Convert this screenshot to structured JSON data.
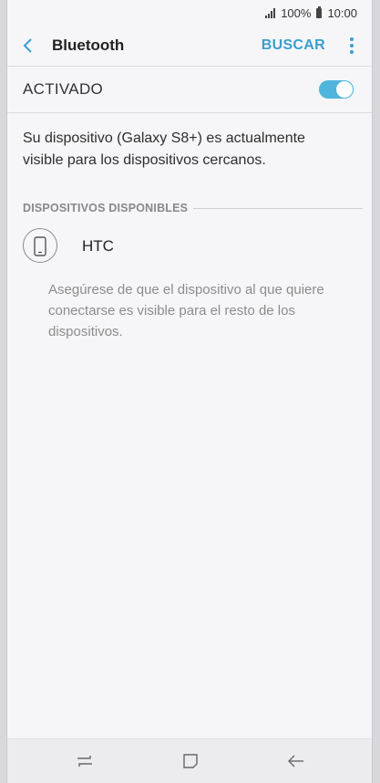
{
  "status_bar": {
    "battery": "100%",
    "time": "10:00"
  },
  "app_bar": {
    "title": "Bluetooth",
    "search_label": "BUSCAR"
  },
  "toggle": {
    "label": "ACTIVADO",
    "state": "on",
    "accent_color": "#4fb5dc"
  },
  "visibility_message": "Su dispositivo (Galaxy S8+) es actualmente visible para los dispositivos cercanos.",
  "available_devices": {
    "header": "DISPOSITIVOS DISPONIBLES",
    "items": [
      {
        "name": "HTC",
        "icon": "smartphone-icon"
      }
    ]
  },
  "hint": "Asegúrese de que el dispositivo al que quiere conectarse es visible para el resto de los dispositivos.",
  "nav_bar": {
    "icons": [
      "recent-apps-icon",
      "home-icon",
      "back-icon"
    ]
  }
}
